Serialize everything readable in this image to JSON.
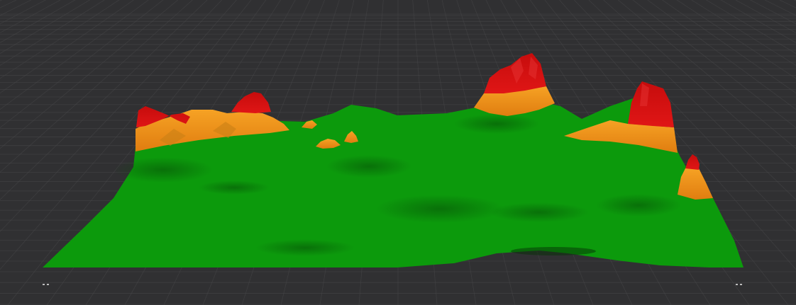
{
  "scene": {
    "background_color": "#303032",
    "grid_color": "#4a4a4c",
    "terrain_colors": {
      "lowland": "#0c9a0c",
      "midland": "#f08c14",
      "highland": "#d31010"
    },
    "markers": [
      "corner-marker",
      "corner-marker"
    ]
  }
}
